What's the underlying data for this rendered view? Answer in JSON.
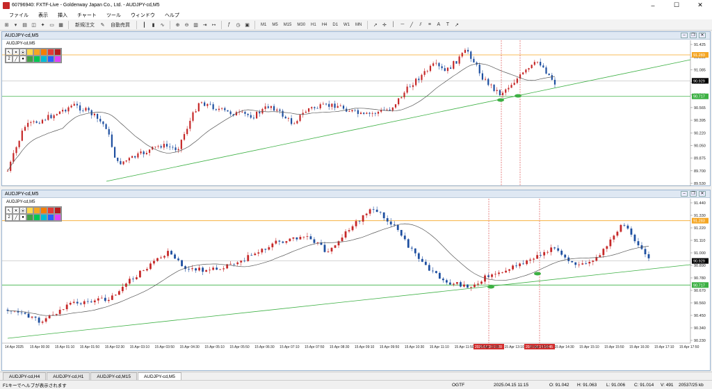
{
  "window": {
    "title": "60796940: FXTF-Live - Goldenway Japan Co., Ltd. - AUDJPY-cd,M5",
    "minimize": "–",
    "maximize": "☐",
    "close": "✕"
  },
  "menu": [
    "ファイル",
    "表示",
    "挿入",
    "チャート",
    "ツール",
    "ウィンドウ",
    "ヘルプ"
  ],
  "toolbar": {
    "new_order": "新規注文",
    "auto_trade": "自動売買",
    "timeframes": [
      "M1",
      "M5",
      "M15",
      "M30",
      "H1",
      "H4",
      "D1",
      "W1",
      "MN"
    ]
  },
  "charts": [
    {
      "header": "AUDJPY-cd,M5",
      "label": "AUDJPY-cd,M5",
      "palette_row2_label": "2",
      "price_ticks": [
        "91.425",
        "91.250",
        "91.085",
        "90.910",
        "90.740",
        "90.565",
        "90.395",
        "90.220",
        "90.050",
        "89.875",
        "89.700",
        "89.530"
      ],
      "current_price": "90.929",
      "green_line_price": "90.717",
      "orange_line_price": "91.283",
      "date_labels": [],
      "marker_labels": []
    },
    {
      "header": "AUDJPY-cd,M5",
      "label": "AUDJPY-cd,M5",
      "palette_row2_label": "2",
      "price_ticks": [
        "91.440",
        "91.330",
        "91.220",
        "91.110",
        "91.000",
        "90.890",
        "90.780",
        "90.670",
        "90.560",
        "90.450",
        "90.340",
        "90.230"
      ],
      "current_price": "90.929",
      "green_line_price": "90.717",
      "orange_line_price": "91.283",
      "date_labels": [
        "14 Apr 2025",
        "15 Apr 00:30",
        "15 Apr 01:10",
        "15 Apr 01:50",
        "15 Apr 02:30",
        "15 Apr 03:10",
        "15 Apr 03:50",
        "15 Apr 04:30",
        "15 Apr 05:10",
        "15 Apr 05:50",
        "15 Apr 06:30",
        "15 Apr 07:10",
        "15 Apr 07:50",
        "15 Apr 08:30",
        "15 Apr 09:10",
        "15 Apr 09:50",
        "15 Apr 10:30",
        "15 Apr 11:10",
        "15 Apr 11:50",
        "15 Apr 12:30",
        "15 Apr 13:10",
        "15 Apr 13:50",
        "15 Apr 14:30",
        "15 Apr 15:10",
        "15 Apr 15:50",
        "15 Apr 16:30",
        "15 Apr 17:10",
        "15 Apr 17:50"
      ],
      "marker_labels": [
        "2025.04.15 13:20",
        "2025.04.15 14:45"
      ]
    }
  ],
  "tabs": [
    "AUDJPY-cd,H4",
    "AUDJPY-cd,H1",
    "AUDJPY-cd,M15",
    "AUDJPY-cd,M5"
  ],
  "active_tab": 3,
  "status": {
    "help": "F1キーでヘルプが表示されます",
    "profile": "OGTF",
    "time": "2025.04.15 11:15",
    "open": "O: 91.042",
    "high": "H: 91.063",
    "low": "L: 91.006",
    "close": "C: 91.014",
    "volume": "V: 491",
    "traffic": "20537/25 kb"
  },
  "colors": {
    "bull": "#c62828",
    "bear": "#1e4fa0",
    "trend": "#3cb043",
    "hline_green": "#3cb043",
    "hline_orange": "#f5a623",
    "ma": "#555555",
    "vline": "#d32f2f"
  }
}
